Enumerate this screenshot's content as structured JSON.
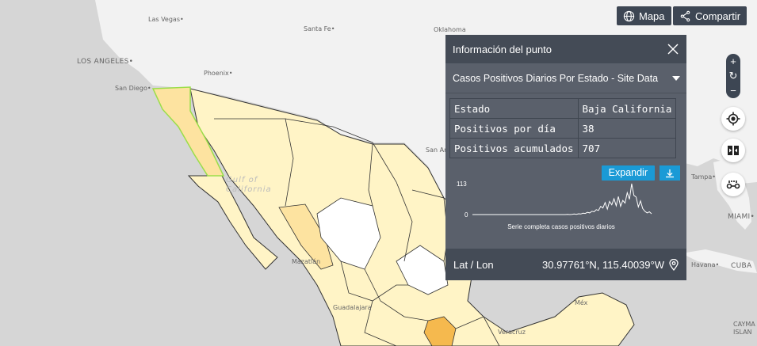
{
  "toolbar": {
    "map_label": "Mapa",
    "share_label": "Compartir"
  },
  "map": {
    "cities": [
      {
        "name": "Las Vegas•"
      },
      {
        "name": "Santa Fe•"
      },
      {
        "name": "Oklahoma"
      },
      {
        "name": "LOS ANGELES•"
      },
      {
        "name": "Phoenix•"
      },
      {
        "name": "San Diego•"
      },
      {
        "name": "San Anton"
      },
      {
        "name": "Mazatlán"
      },
      {
        "name": "Veracruz"
      },
      {
        "name": "Tampa•"
      },
      {
        "name": "MIAMI•"
      },
      {
        "name": "Havana•"
      },
      {
        "name": "CUBA"
      },
      {
        "name": "CAYMA"
      },
      {
        "name": "ISLAN"
      },
      {
        "name": "Guadalajara"
      },
      {
        "name": "Méx"
      }
    ],
    "sea_label": "Gulf of California",
    "colors": {
      "land": "#f2f2f2",
      "water": "#d6d6d6",
      "state_light": "#fff4c6",
      "state_mid": "#fde3a0",
      "state_dark": "#f5b94e",
      "state_white": "#ffffff",
      "selected_border": "#9bde4a"
    }
  },
  "panel": {
    "title": "Información del punto",
    "layer": "Casos Positivos Diarios Por Estado - Site Data",
    "rows": [
      {
        "label": "Estado",
        "value": "Baja California"
      },
      {
        "label": "Positivos por día",
        "value": "38"
      },
      {
        "label": "Positivos acumulados",
        "value": "707"
      }
    ],
    "expand_label": "Expandir",
    "chart_caption": "Serie completa casos positivos diarios",
    "chart_max_label": "113",
    "chart_min_label": "0",
    "latlon_label": "Lat / Lon",
    "latlon_value": "30.97761°N, 115.40039°W"
  },
  "chart_data": {
    "type": "line",
    "title": "Serie completa casos positivos diarios",
    "ylim": [
      0,
      113
    ],
    "values": [
      0,
      0,
      0,
      0,
      0,
      0,
      0,
      0,
      0,
      0,
      0,
      0,
      0,
      0,
      0,
      0,
      0,
      0,
      0,
      0,
      0,
      0,
      0,
      0,
      0,
      0,
      0,
      0,
      0,
      0,
      0,
      0,
      0,
      0,
      0,
      0,
      0,
      0,
      0,
      0,
      0,
      0,
      0,
      1,
      0,
      1,
      2,
      1,
      3,
      2,
      5,
      4,
      8,
      6,
      12,
      10,
      18,
      15,
      30,
      24,
      44,
      20,
      48,
      36,
      58,
      32,
      66,
      30,
      52,
      42,
      80,
      56,
      113,
      70,
      64,
      28,
      50,
      22,
      12,
      6,
      10,
      3
    ]
  }
}
